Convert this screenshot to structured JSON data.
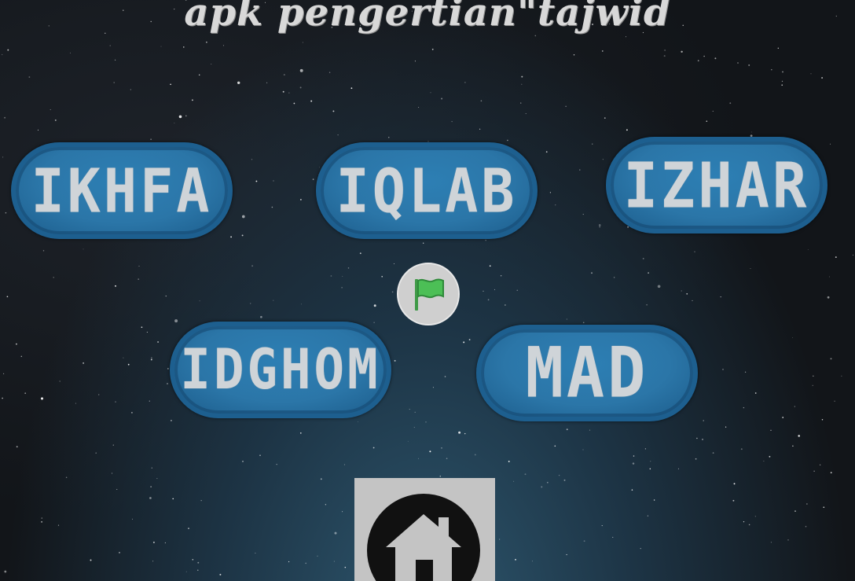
{
  "title": "apk pengertian\"tajwid",
  "buttons": {
    "ikhfa": "IKHFA",
    "iqlab": "IQLAB",
    "izhar": "IZHAR",
    "idghom": "IDGHOM",
    "mad": "MAD"
  },
  "icons": {
    "start": "green-flag-icon",
    "home": "home-icon"
  },
  "colors": {
    "button_fill": "#2b76a8",
    "button_border": "#1d5f8f",
    "button_text": "#cfd4d8",
    "flag_green": "#4cbf56",
    "title_text": "#d8d8d8"
  }
}
